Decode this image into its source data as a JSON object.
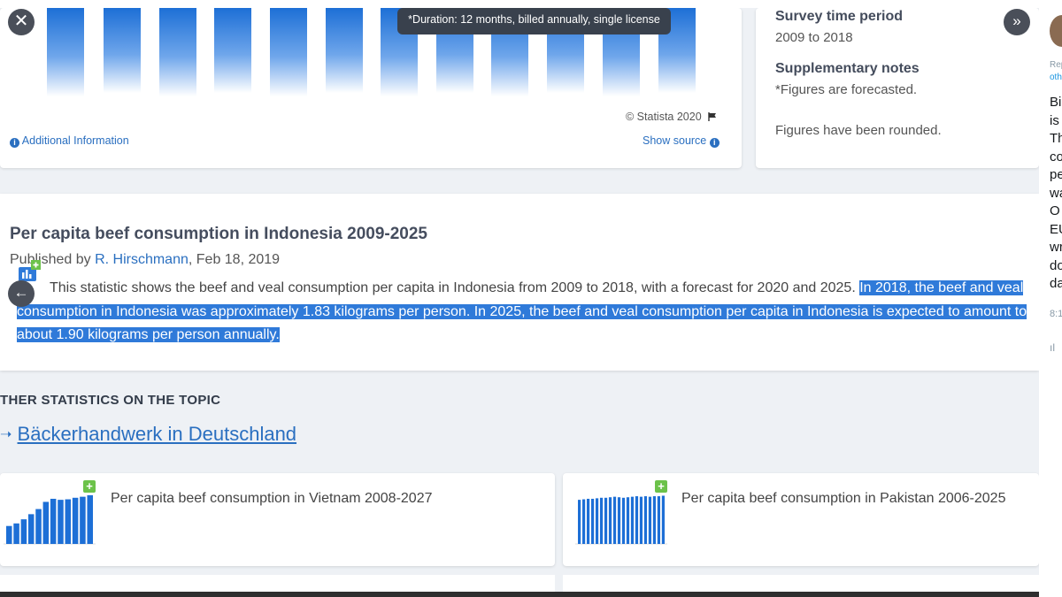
{
  "tooltip": {
    "text": "*Duration: 12 months, billed annually, single license"
  },
  "chart_card": {
    "copyright": "© Statista 2020",
    "additional_info": "Additional Information",
    "show_source": "Show source"
  },
  "side_card": {
    "survey_heading": "Survey time period",
    "survey_value": "2009 to 2018",
    "notes_heading": "Supplementary notes",
    "note1": "*Figures are forecasted.",
    "note2": "Figures have been rounded."
  },
  "description": {
    "title": "Per capita beef consumption in Indonesia 2009-2025",
    "published_prefix": "Published by ",
    "author": "R. Hirschmann",
    "published_suffix": ", Feb 18, 2019",
    "text_plain": "This statistic shows the beef and veal consumption per capita in Indonesia from 2009 to 2018, with a forecast for 2020 and 2025. ",
    "text_highlight": "In 2018, the beef and veal consumption in Indonesia was approximately 1.83 kilograms per person. In 2025, the beef and veal consumption per capita in Indonesia is expected to amount to about 1.90 kilograms per person annually."
  },
  "other": {
    "heading": "THER STATISTICS ON THE TOPIC",
    "arrow": "➝",
    "link": "Bäckerhandwerk in Deutschland"
  },
  "related": [
    {
      "title": "Per capita beef consumption in Vietnam 2008-2027"
    },
    {
      "title": "Per capita beef consumption in Pakistan 2006-2025"
    }
  ],
  "thumb_levels": {
    "vietnam": [
      0.35,
      0.4,
      0.48,
      0.58,
      0.68,
      0.82,
      0.88,
      0.86,
      0.87,
      0.9,
      0.92,
      0.95
    ],
    "pakistan": [
      0.86,
      0.87,
      0.88,
      0.88,
      0.89,
      0.9,
      0.9,
      0.91,
      0.92,
      0.91,
      0.9,
      0.91,
      0.92,
      0.93,
      0.92,
      0.93,
      0.92,
      0.93,
      0.93,
      0.94
    ]
  },
  "right_panel": {
    "small1": "Rep",
    "small2": "oth",
    "lines": [
      "Bi",
      "is",
      "Th",
      "co",
      "pe",
      "wa",
      "O",
      "EU",
      "wr",
      "do",
      "da"
    ],
    "time": "8:1",
    "stats_icon": "ıl"
  },
  "icons": {
    "close": "close-icon",
    "next": "double-chevron-right-icon",
    "prev": "arrow-left-icon",
    "info": "info-icon",
    "flag": "flag-icon",
    "stat": "statistic-chart-icon",
    "plus": "plus-icon"
  },
  "colors": {
    "accent": "#2a6fc0",
    "highlight": "#2f7ad9",
    "bar": "#1d6fd6",
    "plus": "#6cc24a"
  }
}
